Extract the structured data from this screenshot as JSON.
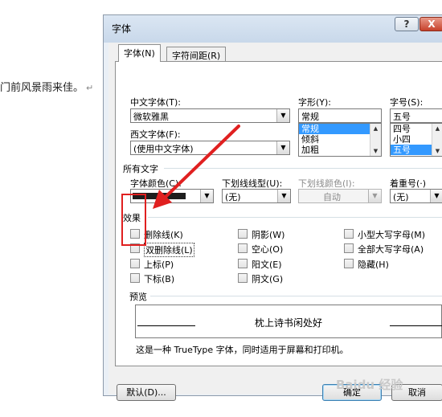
{
  "document": {
    "text": "门前风景雨来佳。",
    "return_mark": "↵"
  },
  "dialog": {
    "title": "字体",
    "help_label": "?",
    "close_label": "X",
    "tabs": [
      {
        "label": "字体(N)",
        "active": true
      },
      {
        "label": "字符间距(R)",
        "active": false
      }
    ],
    "chinese_font": {
      "label": "中文字体(T):",
      "value": "微软雅黑"
    },
    "western_font": {
      "label": "西文字体(F):",
      "value": "(使用中文字体)"
    },
    "style": {
      "label": "字形(Y):",
      "value": "常规",
      "options": [
        "常规",
        "倾斜",
        "加粗"
      ],
      "selected": "常规"
    },
    "size": {
      "label": "字号(S):",
      "value": "五号",
      "options": [
        "四号",
        "小四",
        "五号"
      ],
      "selected": "五号"
    },
    "all_text": {
      "title": "所有文字",
      "font_color_label": "字体颜色(C):",
      "font_color_value": "#1e1e1e",
      "underline_type_label": "下划线线型(U):",
      "underline_type_value": "(无)",
      "underline_color_label": "下划线颜色(I):",
      "underline_color_value": "自动",
      "emphasis_label": "着重号(·)",
      "emphasis_value": "(无)"
    },
    "effects": {
      "title": "效果",
      "col1": [
        "删除线(K)",
        "双删除线(L)",
        "上标(P)",
        "下标(B)"
      ],
      "col2": [
        "阴影(W)",
        "空心(O)",
        "阳文(E)",
        "阴文(G)"
      ],
      "col3": [
        "小型大写字母(M)",
        "全部大写字母(A)",
        "隐藏(H)"
      ]
    },
    "preview": {
      "title": "预览",
      "sample_text": "枕上诗书闲处好",
      "note": "这是一种 TrueType 字体，同时适用于屏幕和打印机。"
    },
    "buttons": {
      "default_label": "默认(D)...",
      "ok_label": "确定",
      "cancel_label": "取消"
    },
    "annotation_color": "#e02020"
  },
  "watermark": "Baidu 经验"
}
